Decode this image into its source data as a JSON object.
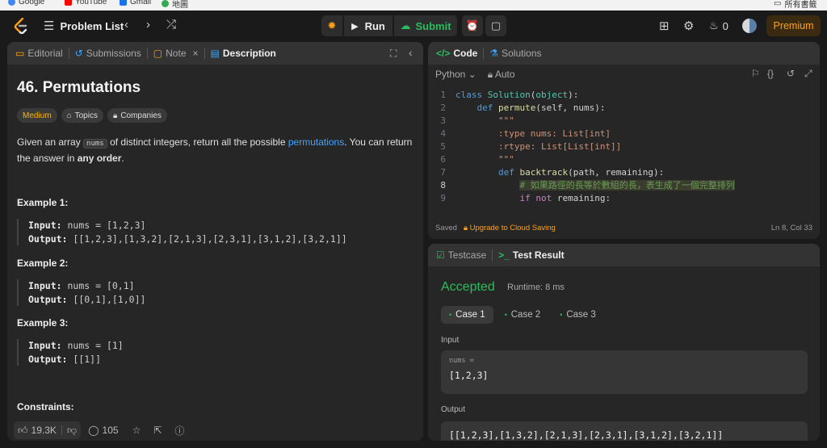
{
  "bookmarks": [
    {
      "label": "Google",
      "color": "#4285f4"
    },
    {
      "label": "YouTube",
      "color": "#ff0000"
    },
    {
      "label": "Gmail",
      "color": "#1a73e8"
    },
    {
      "label": "地圖",
      "color": "#34a853"
    }
  ],
  "bookmarks_right": "所有書籤",
  "nav": {
    "problem_list": "Problem List",
    "run_label": "Run",
    "submit_label": "Submit",
    "streak_count": "0",
    "premium_label": "Premium"
  },
  "left_tabs": {
    "editorial": "Editorial",
    "submissions": "Submissions",
    "note": "Note",
    "description": "Description"
  },
  "problem": {
    "title": "46. Permutations",
    "difficulty": "Medium",
    "topics": "Topics",
    "companies": "Companies",
    "statement_a": "Given an array ",
    "statement_code": "nums",
    "statement_b": " of distinct integers, return all the possible ",
    "statement_link": "permutations",
    "statement_c": ". You can return the answer in ",
    "statement_bold": "any order",
    "statement_d": ".",
    "examples": [
      {
        "title": "Example 1:",
        "input_label": "Input:",
        "input": "nums = [1,2,3]",
        "output_label": "Output:",
        "output": "[[1,2,3],[1,3,2],[2,1,3],[2,3,1],[3,1,2],[3,2,1]]"
      },
      {
        "title": "Example 2:",
        "input_label": "Input:",
        "input": "nums = [0,1]",
        "output_label": "Output:",
        "output": "[[0,1],[1,0]]"
      },
      {
        "title": "Example 3:",
        "input_label": "Input:",
        "input": "nums = [1]",
        "output_label": "Output:",
        "output": "[[1]]"
      }
    ],
    "constraints": "Constraints:"
  },
  "footer": {
    "likes": "19.3K",
    "comments": "105"
  },
  "code_tabs": {
    "code": "Code",
    "solutions": "Solutions"
  },
  "editor": {
    "language": "Python",
    "mode": "Auto",
    "lines": [
      {
        "n": "1",
        "tokens": [
          [
            "kw",
            "class "
          ],
          [
            "cls",
            "Solution"
          ],
          [
            "tx",
            "("
          ],
          [
            "cls",
            "object"
          ],
          [
            "tx",
            "):"
          ]
        ]
      },
      {
        "n": "2",
        "tokens": [
          [
            "tx",
            "    "
          ],
          [
            "kw",
            "def "
          ],
          [
            "fn",
            "permute"
          ],
          [
            "tx",
            "("
          ],
          [
            "tx",
            "self, nums"
          ],
          [
            "tx",
            "):"
          ]
        ]
      },
      {
        "n": "3",
        "tokens": [
          [
            "tx",
            "        "
          ],
          [
            "str",
            "\"\"\""
          ]
        ]
      },
      {
        "n": "4",
        "tokens": [
          [
            "tx",
            "        "
          ],
          [
            "str",
            ":type nums: List[int]"
          ]
        ]
      },
      {
        "n": "5",
        "tokens": [
          [
            "tx",
            "        "
          ],
          [
            "str",
            ":rtype: List[List[int]]"
          ]
        ]
      },
      {
        "n": "6",
        "tokens": [
          [
            "tx",
            "        "
          ],
          [
            "str",
            "\"\"\""
          ]
        ]
      },
      {
        "n": "7",
        "tokens": [
          [
            "tx",
            "        "
          ],
          [
            "kw",
            "def "
          ],
          [
            "fn",
            "backtrack"
          ],
          [
            "tx",
            "(path, remaining):"
          ]
        ]
      },
      {
        "n": "8",
        "tokens": [
          [
            "tx",
            "            "
          ],
          [
            "cm",
            "# 如果路徑的長等於數組的長，表生成了一個完整排列"
          ]
        ]
      },
      {
        "n": "9",
        "tokens": [
          [
            "tx",
            "            "
          ],
          [
            "ky",
            "if not "
          ],
          [
            "tx",
            "remaining:"
          ]
        ]
      }
    ],
    "saved": "Saved",
    "upgrade": "Upgrade to Cloud Saving",
    "cursor": "Ln 8, Col 33"
  },
  "result_tabs": {
    "testcase": "Testcase",
    "test_result": "Test Result"
  },
  "result": {
    "status": "Accepted",
    "runtime": "Runtime: 8 ms",
    "cases": [
      "Case 1",
      "Case 2",
      "Case 3"
    ],
    "input_label": "Input",
    "input_var": "nums =",
    "input_value": "[1,2,3]",
    "output_label": "Output",
    "output_value": "[[1,2,3],[1,3,2],[2,1,3],[2,3,1],[3,1,2],[3,2,1]]"
  },
  "colors": {
    "accent_green": "#2cbb5d",
    "medium_yellow": "#ffb800",
    "premium_orange": "#ffa116",
    "link_blue": "#3ea6ff"
  }
}
